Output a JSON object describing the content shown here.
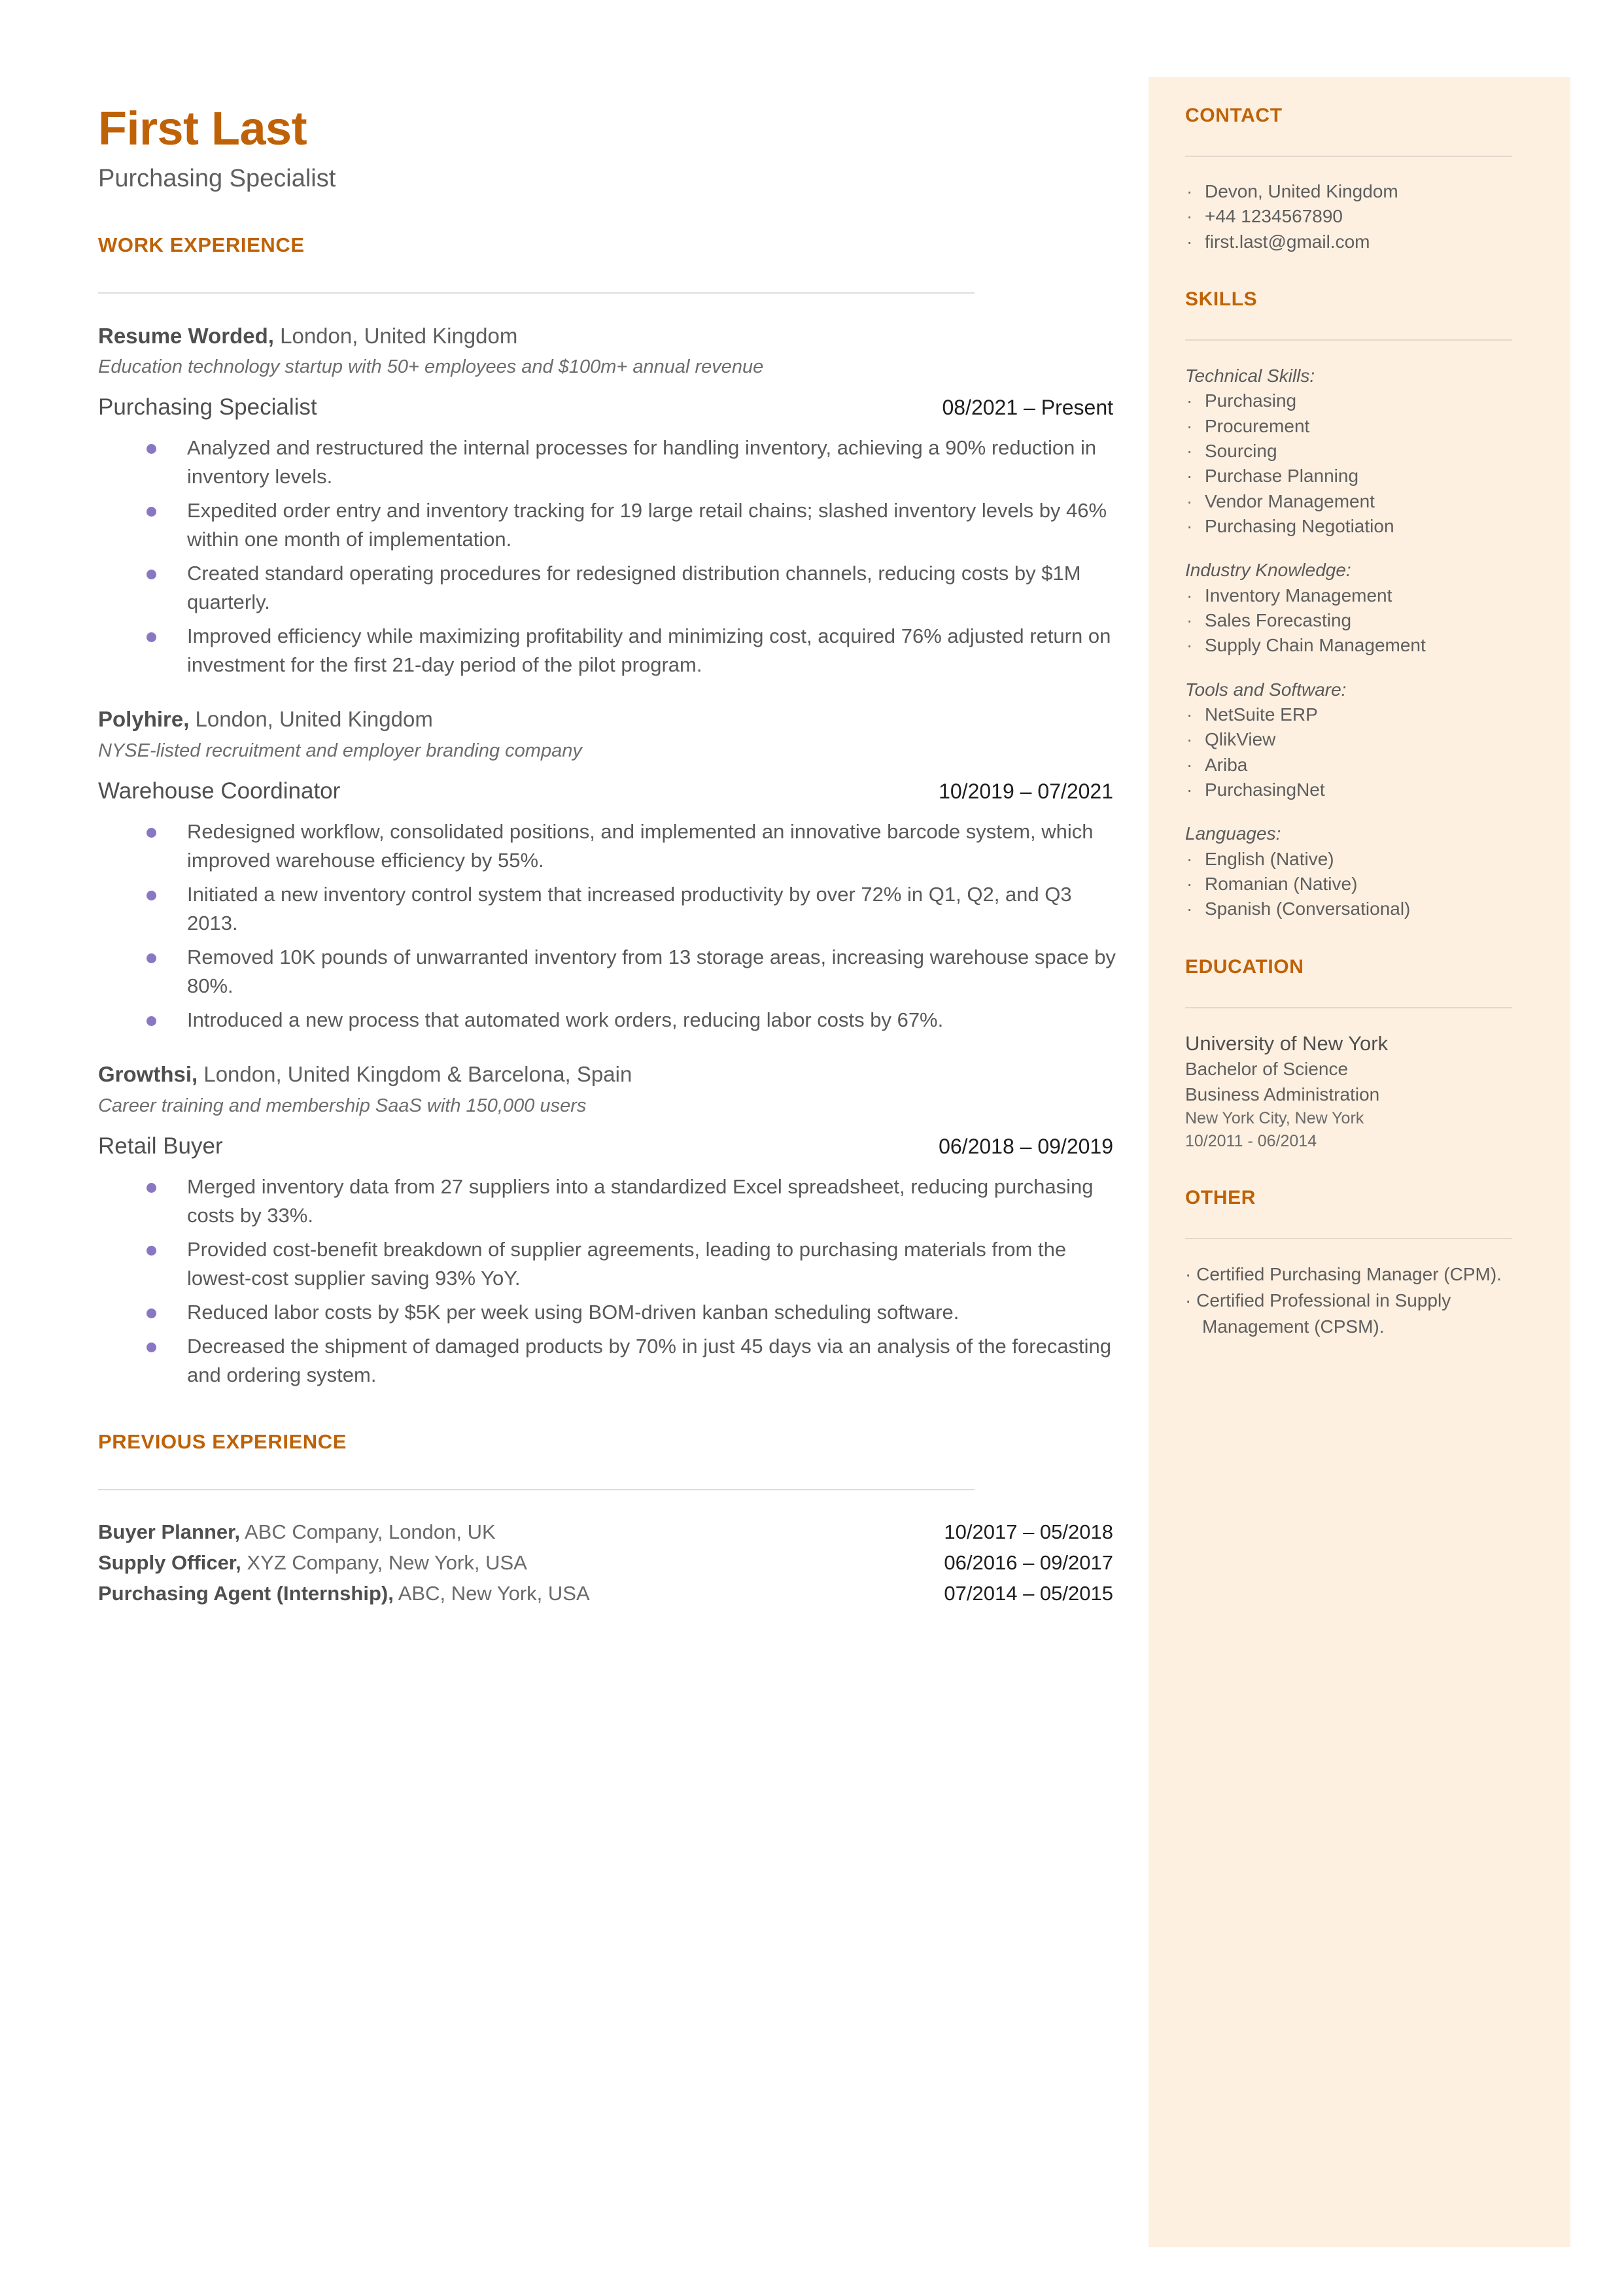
{
  "colors": {
    "accent": "#bf6207",
    "sidebar_bg": "#fdf0e1",
    "bullet": "#8977c4",
    "body_text": "#5e5e5e"
  },
  "header": {
    "name": "First Last",
    "title": "Purchasing Specialist"
  },
  "work_experience": {
    "heading": "WORK EXPERIENCE",
    "jobs": [
      {
        "company": "Resume Worded,",
        "location": " London, United Kingdom",
        "description": "Education technology startup with 50+ employees and $100m+ annual revenue",
        "role": "Purchasing Specialist",
        "dates": "08/2021 – Present",
        "bullets": [
          "Analyzed and restructured the internal processes for handling inventory, achieving a 90% reduction in inventory levels.",
          "Expedited order entry and inventory tracking for 19 large retail chains; slashed inventory levels by 46% within one month of implementation.",
          "Created standard operating procedures for redesigned distribution channels, reducing costs by $1M quarterly.",
          "Improved efficiency while maximizing profitability and minimizing cost, acquired 76% adjusted return on investment for the first 21-day period of the pilot program."
        ]
      },
      {
        "company": "Polyhire,",
        "location": " London, United Kingdom",
        "description": "NYSE-listed recruitment and employer branding company",
        "role": "Warehouse Coordinator",
        "dates": "10/2019 – 07/2021",
        "bullets": [
          "Redesigned workflow, consolidated positions, and implemented an innovative barcode system, which improved warehouse efficiency by 55%.",
          "Initiated a new inventory control system that increased productivity by over 72% in Q1, Q2, and Q3 2013.",
          "Removed 10K pounds of unwarranted inventory from 13  storage areas, increasing warehouse space by 80%.",
          "Introduced a new process that automated work orders, reducing labor costs by 67%."
        ]
      },
      {
        "company": "Growthsi,",
        "location": " London, United Kingdom & Barcelona, Spain",
        "description": "Career training and membership SaaS with 150,000 users",
        "role": "Retail Buyer",
        "dates": "06/2018 – 09/2019",
        "bullets": [
          "Merged inventory data from 27 suppliers into a standardized Excel spreadsheet, reducing purchasing costs by 33%.",
          "Provided cost-benefit breakdown of supplier agreements, leading to purchasing materials from the lowest-cost supplier saving 93% YoY.",
          "Reduced labor costs by $5K per week using BOM-driven kanban scheduling software.",
          "Decreased the shipment of damaged products by 70% in just 45 days via an analysis of the forecasting and ordering system."
        ]
      }
    ]
  },
  "previous_experience": {
    "heading": "PREVIOUS EXPERIENCE",
    "rows": [
      {
        "role": "Buyer Planner,",
        "detail": " ABC Company, London, UK",
        "dates": "10/2017 – 05/2018"
      },
      {
        "role": "Supply Officer,",
        "detail": " XYZ Company, New York, USA",
        "dates": "06/2016 – 09/2017"
      },
      {
        "role": "Purchasing Agent (Internship),",
        "detail": " ABC, New York, USA",
        "dates": "07/2014 – 05/2015"
      }
    ]
  },
  "sidebar": {
    "contact": {
      "heading": "CONTACT",
      "items": [
        " Devon, United Kingdom",
        "+44 1234567890",
        "first.last@gmail.com"
      ]
    },
    "skills": {
      "heading": "SKILLS",
      "groups": [
        {
          "label": "Technical Skills:",
          "items": [
            "Purchasing",
            "Procurement",
            "Sourcing",
            "Purchase Planning",
            "Vendor Management",
            "Purchasing Negotiation"
          ]
        },
        {
          "label": "Industry Knowledge:",
          "items": [
            "Inventory Management",
            "Sales Forecasting",
            "Supply Chain Management"
          ]
        },
        {
          "label": "Tools and Software:",
          "items": [
            "NetSuite ERP",
            "QlikView",
            "Ariba",
            "PurchasingNet"
          ]
        },
        {
          "label": "Languages:",
          "items": [
            "English (Native)",
            "Romanian (Native)",
            "Spanish (Conversational)"
          ]
        }
      ]
    },
    "education": {
      "heading": "EDUCATION",
      "school": "University of New York",
      "degree": "Bachelor of Science",
      "field": "Business Administration",
      "location": "New York City, New York",
      "dates": "10/2011 - 06/2014"
    },
    "other": {
      "heading": "OTHER",
      "items": [
        " Certified Purchasing Manager (CPM).",
        " Certified Professional in Supply Management (CPSM)."
      ]
    }
  }
}
